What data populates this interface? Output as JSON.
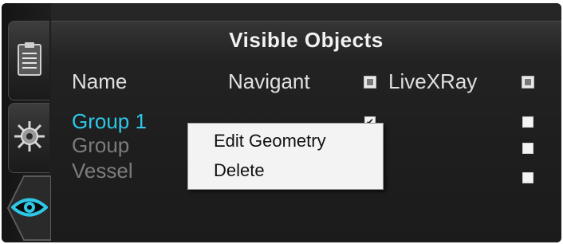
{
  "panel": {
    "title": "Visible Objects"
  },
  "columns": {
    "name": "Name",
    "navigant": "Navigant",
    "livexray": "LiveXRay"
  },
  "header_checks": {
    "navigant": "mixed",
    "livexray": "mixed"
  },
  "rows": [
    {
      "name": "Group 1",
      "navigant": true,
      "livexray": false,
      "selected": true
    },
    {
      "name": "Group",
      "navigant": false,
      "livexray": false,
      "selected": false
    },
    {
      "name": "Vessel",
      "navigant": true,
      "livexray": false,
      "selected": false
    }
  ],
  "context_menu": {
    "items": [
      {
        "label": "Edit Geometry"
      },
      {
        "label": "Delete"
      }
    ]
  },
  "rail": {
    "tabs": [
      {
        "icon": "clipboard-icon"
      },
      {
        "icon": "gear-icon"
      },
      {
        "icon": "eye-icon",
        "active": true
      }
    ]
  },
  "colors": {
    "selected_text": "#2fc7e6",
    "accent_eye": "#2fc7e6",
    "panel_bg": "#1f1f1f"
  },
  "checkmark": "✔"
}
